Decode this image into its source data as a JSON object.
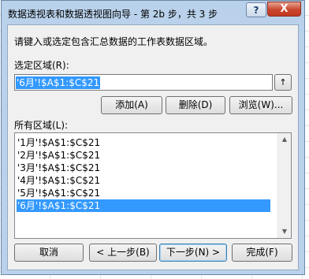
{
  "dialog": {
    "title": "数据透视表和数据透视图向导 - 第 2b 步，共 3 步",
    "help_glyph": "?",
    "close_glyph": "X",
    "instruction": "请键入或选定包含汇总数据的工作表数据区域。",
    "selected_range_label": "选定区域(R):",
    "selected_range_value": "'6月'!$A$1:$C$21",
    "collapse_glyph": "↑",
    "add_button": "添加(A)",
    "delete_button": "删除(D)",
    "browse_button": "浏览(W)...",
    "all_ranges_label": "所有区域(L):",
    "all_ranges": [
      "'1月'!$A$1:$C$21",
      "'2月'!$A$1:$C$21",
      "'3月'!$A$1:$C$21",
      "'4月'!$A$1:$C$21",
      "'5月'!$A$1:$C$21",
      "'6月'!$A$1:$C$21"
    ],
    "selected_index": 5,
    "scroll_up_glyph": "▲",
    "scroll_down_glyph": "▼",
    "cancel_button": "取消",
    "back_button": "< 上一步(B)",
    "next_button": "下一步(N) >",
    "finish_button": "完成(F)"
  }
}
